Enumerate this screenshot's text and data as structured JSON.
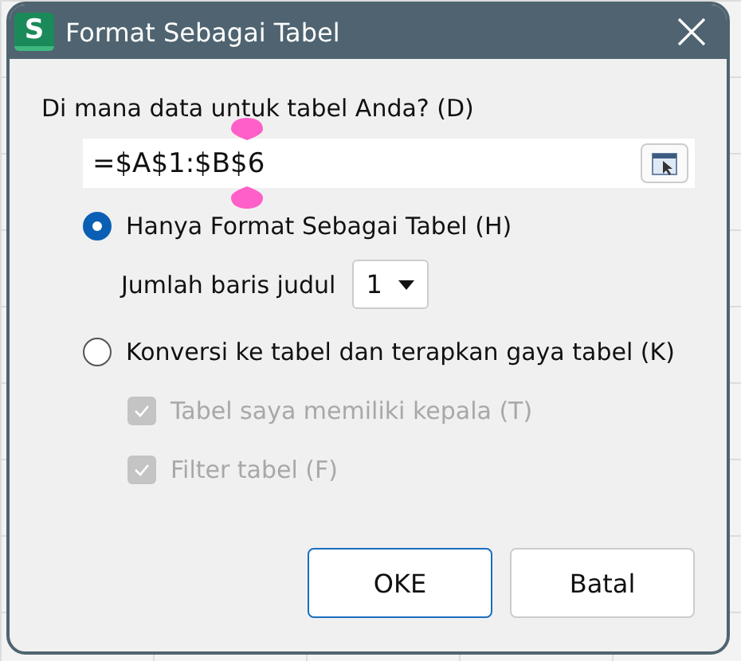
{
  "window": {
    "title": "Format Sebagai Tabel",
    "app_icon": "S"
  },
  "prompt": "Di mana data untuk tabel Anda? (D)",
  "range_field": {
    "value": "=$A$1:$B$6",
    "selection_handles": true
  },
  "options": [
    {
      "label": "Hanya Format Sebagai Tabel (H)",
      "selected": true
    },
    {
      "label": "Konversi ke tabel dan terapkan gaya tabel (K)",
      "selected": false
    }
  ],
  "header_rows": {
    "label": "Jumlah baris judul",
    "value": "1"
  },
  "checkboxes": [
    {
      "label": "Tabel saya memiliki kepala (T)",
      "checked": true,
      "disabled": true
    },
    {
      "label": "Filter tabel (F)",
      "checked": true,
      "disabled": true
    }
  ],
  "buttons": [
    {
      "label": "OKE",
      "default": true
    },
    {
      "label": "Batal",
      "default": false
    }
  ]
}
